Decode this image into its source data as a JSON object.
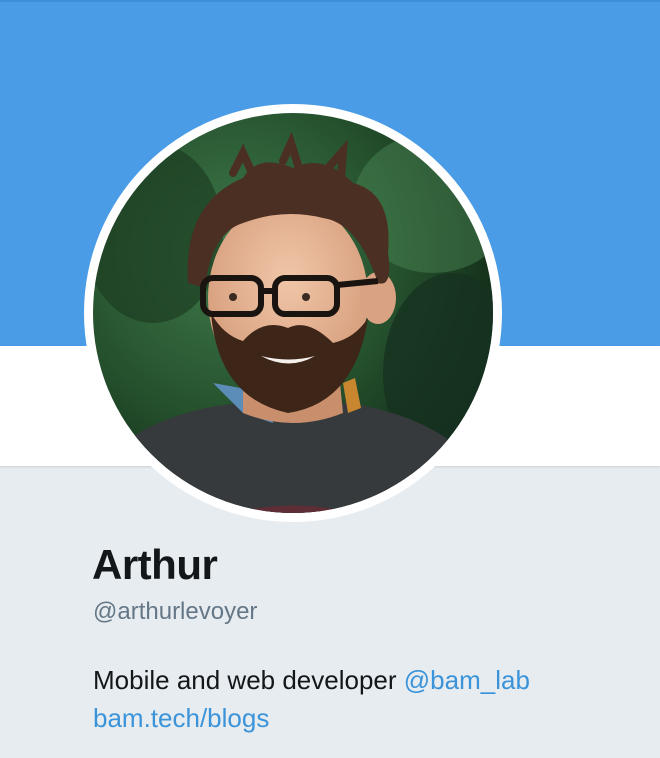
{
  "profile": {
    "name": "Arthur",
    "handle": "@arthurlevoyer",
    "bio_text": "Mobile and web developer",
    "bio_mention": "@bam_lab",
    "bio_url": "bam.tech/blogs"
  },
  "colors": {
    "banner": "#4a9ce6",
    "background": "#e6ecf0",
    "link": "#3b94d9",
    "name": "#14171a",
    "handle": "#657786"
  },
  "icons": {
    "avatar": "profile-photo"
  }
}
